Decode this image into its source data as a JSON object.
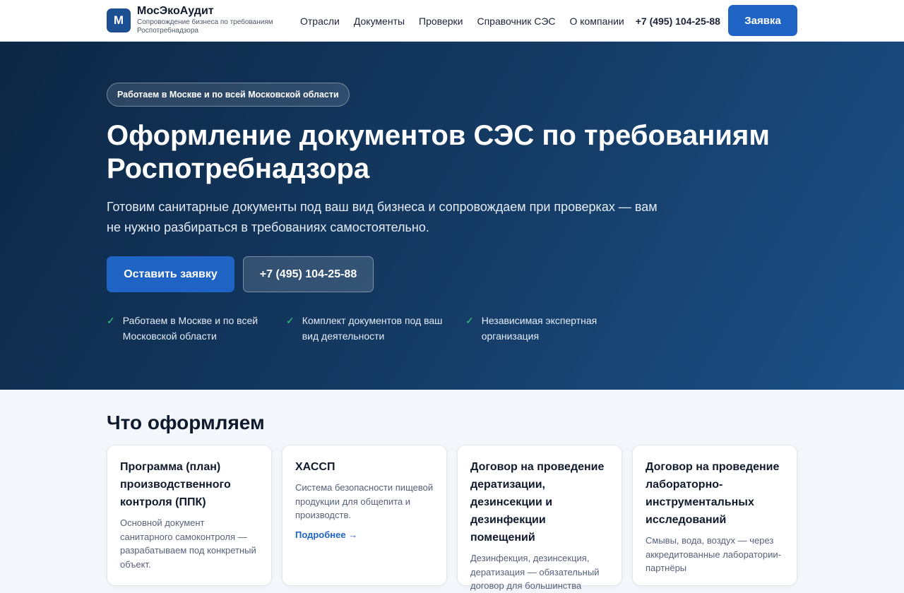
{
  "header": {
    "logo_letter": "М",
    "brand_name": "МосЭкоАудит",
    "brand_sub": "Сопровождение бизнеса по требованиям Роспотребнадзора",
    "nav": [
      "Отрасли",
      "Документы",
      "Проверки",
      "Справочник СЭС",
      "О компании"
    ],
    "phone": "+7 (495) 104-25-88",
    "cta": "Заявка"
  },
  "hero": {
    "pill": "Работаем в Москве и по всей Московской области",
    "title": "Оформление документов СЭС по требованиям Роспотребнадзора",
    "lead": "Готовим санитарные документы под ваш вид бизнеса и сопровождаем при проверках — вам не нужно разбираться в требованиях самостоятельно.",
    "btn_primary": "Оставить заявку",
    "btn_secondary": "+7 (495) 104-25-88",
    "features": [
      "Работаем в Москве и по всей Московской области",
      "Комплект документов под ваш вид деятельности",
      "Независимая экспертная организация"
    ]
  },
  "services": {
    "title": "Что оформляем",
    "cards": [
      {
        "title": "Программа (план) производственного контроля (ППК)",
        "desc": "Основной документ санитарного самоконтроля — разрабатываем под конкретный объект.",
        "link": ""
      },
      {
        "title": "ХАССП",
        "desc": "Система безопасности пищевой продукции для общепита и производств.",
        "link": "Подробнее →"
      },
      {
        "title": "Договор на проведение дератизации, дезинсекции и дезинфекции помещений",
        "desc": "Дезинфекция, дезинсекция, дератизация — обязательный договор для большинства",
        "link": ""
      },
      {
        "title": "Договор на проведение лабораторно-инструментальных исследований",
        "desc": "Смывы, вода, воздух — через аккредитованные лаборатории-партнёры",
        "link": ""
      }
    ]
  },
  "colors": {
    "accent": "#1f63c4",
    "hero_dark": "#0d2745",
    "check": "#39c97a"
  }
}
